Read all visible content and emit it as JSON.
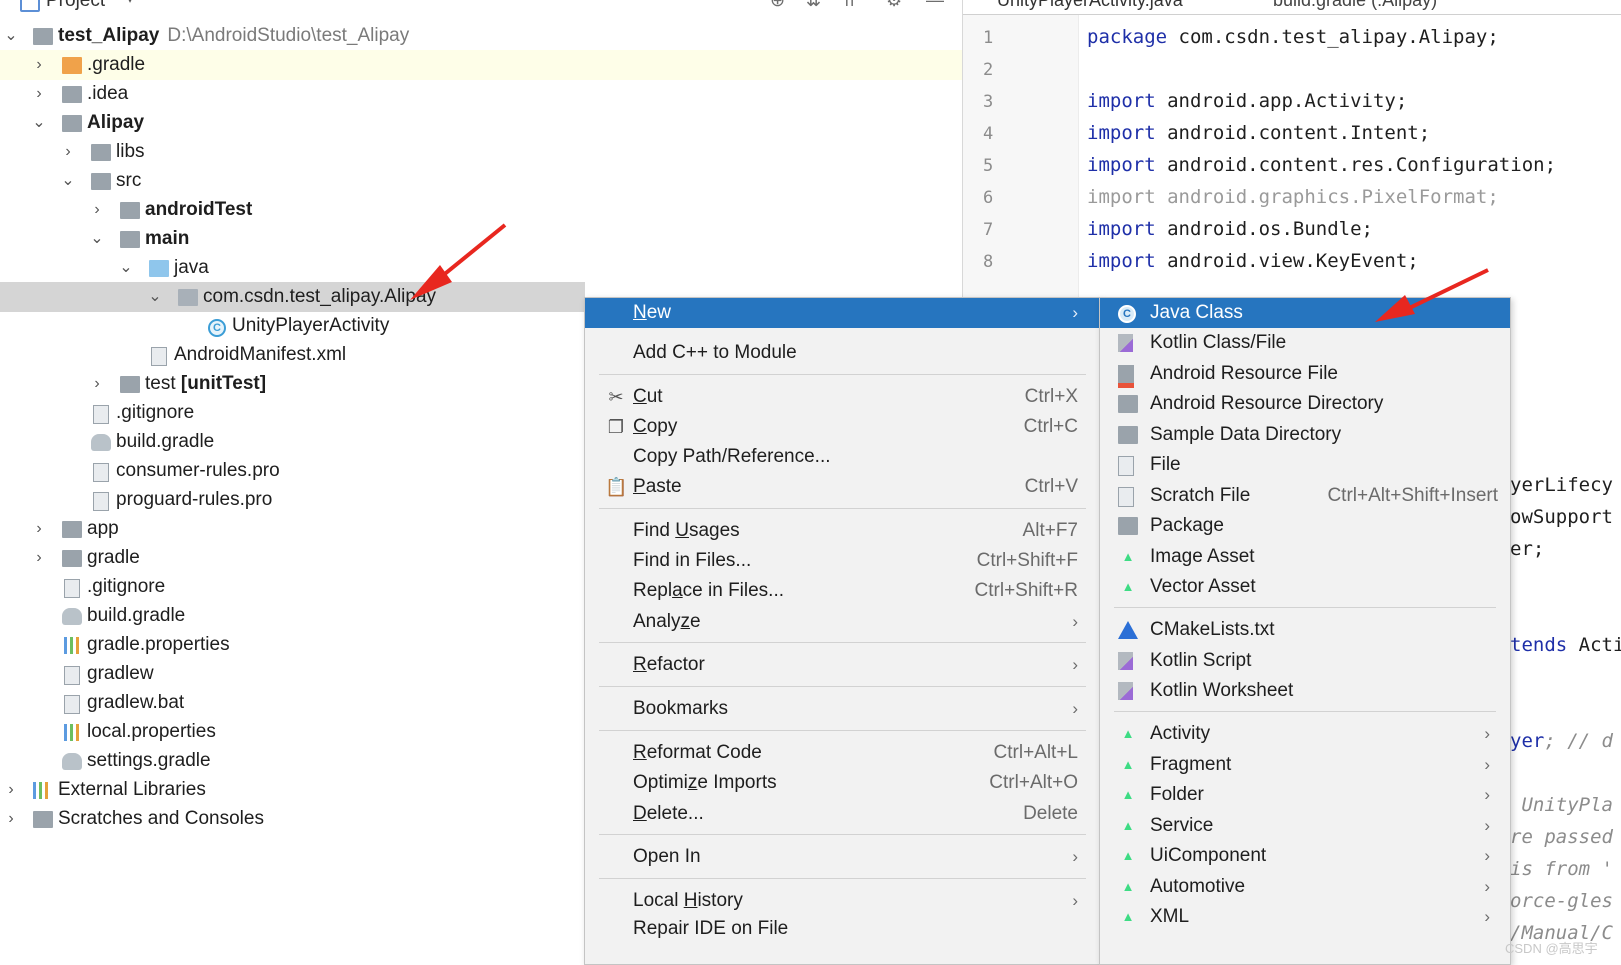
{
  "project_panel": {
    "title": "Project",
    "tree": [
      {
        "label": "test_Alipay",
        "path": "D:\\AndroidStudio\\test_Alipay"
      },
      {
        "label": ".gradle"
      },
      {
        "label": ".idea"
      },
      {
        "label": "Alipay"
      },
      {
        "label": "libs"
      },
      {
        "label": "src"
      },
      {
        "label": "androidTest"
      },
      {
        "label": "main"
      },
      {
        "label": "java"
      },
      {
        "label": "com.csdn.test_alipay.Alipay"
      },
      {
        "label": "UnityPlayerActivity"
      },
      {
        "label": "AndroidManifest.xml"
      },
      {
        "label": "test",
        "suffix": "[unitTest]"
      },
      {
        "label": ".gitignore"
      },
      {
        "label": "build.gradle"
      },
      {
        "label": "consumer-rules.pro"
      },
      {
        "label": "proguard-rules.pro"
      },
      {
        "label": "app"
      },
      {
        "label": "gradle"
      },
      {
        "label": ".gitignore"
      },
      {
        "label": "build.gradle"
      },
      {
        "label": "gradle.properties"
      },
      {
        "label": "gradlew"
      },
      {
        "label": "gradlew.bat"
      },
      {
        "label": "local.properties"
      },
      {
        "label": "settings.gradle"
      },
      {
        "label": "External Libraries"
      },
      {
        "label": "Scratches and Consoles"
      }
    ]
  },
  "editor": {
    "tabs": [
      "UnityPlayerActivity.java",
      "build.gradle (:Alipay)"
    ],
    "lines": [
      {
        "num": "1",
        "kw": "package",
        "rest": " com.csdn.test_alipay.Alipay;"
      },
      {
        "num": "2",
        "kw": "",
        "rest": ""
      },
      {
        "num": "3",
        "kw": "import",
        "rest": " android.app.Activity;"
      },
      {
        "num": "4",
        "kw": "import",
        "rest": " android.content.Intent;"
      },
      {
        "num": "5",
        "kw": "import",
        "rest": " android.content.res.Configuration;"
      },
      {
        "num": "6",
        "kw": "import",
        "rest": " android.graphics.PixelFormat;"
      },
      {
        "num": "7",
        "kw": "import",
        "rest": " android.os.Bundle;"
      },
      {
        "num": "8",
        "kw": "import",
        "rest": " android.view.KeyEvent;"
      }
    ],
    "partial": {
      "p1": "yerLifecy",
      "p2": "owSupport",
      "p3": "er;",
      "p4_kw": "tends",
      "p4_rest": " Acti",
      "p5_kw": "yer",
      "p5_rest": "; // d",
      "p6": " UnityPla",
      "p7": "re passed",
      "p8": "is from '",
      "p9": "orce-gles",
      "p10": "/Manual/C"
    }
  },
  "context_menu": {
    "items": [
      {
        "label": "New",
        "u": "N",
        "rest": "ew"
      },
      {
        "label": "Add C++ to Module"
      },
      {
        "label": "Cut",
        "u": "C",
        "rest": "ut",
        "shortcut": "Ctrl+X"
      },
      {
        "label": "Copy",
        "u": "C",
        "rest": "opy",
        "shortcut": "Ctrl+C"
      },
      {
        "label": "Copy Path/Reference..."
      },
      {
        "label": "Paste",
        "u": "P",
        "rest": "aste",
        "shortcut": "Ctrl+V"
      },
      {
        "label": "Find Usages",
        "pre": "Find ",
        "u": "U",
        "rest": "sages",
        "shortcut": "Alt+F7"
      },
      {
        "label": "Find in Files...",
        "shortcut": "Ctrl+Shift+F"
      },
      {
        "label": "Replace in Files...",
        "pre": "Repl",
        "u": "a",
        "rest": "ce in Files...",
        "shortcut": "Ctrl+Shift+R"
      },
      {
        "label": "Analyze",
        "pre": "Analy",
        "u": "z",
        "rest": "e"
      },
      {
        "label": "Refactor",
        "u": "R",
        "rest": "efactor"
      },
      {
        "label": "Bookmarks"
      },
      {
        "label": "Reformat Code",
        "u": "R",
        "rest": "eformat Code",
        "shortcut": "Ctrl+Alt+L"
      },
      {
        "label": "Optimize Imports",
        "pre": "Optimi",
        "u": "z",
        "rest": "e Imports",
        "shortcut": "Ctrl+Alt+O"
      },
      {
        "label": "Delete...",
        "u": "D",
        "rest": "elete...",
        "shortcut": "Delete"
      },
      {
        "label": "Open In"
      },
      {
        "label": "Local History",
        "pre": "Local ",
        "u": "H",
        "rest": "istory"
      },
      {
        "label": "Repair IDE on File"
      }
    ]
  },
  "new_submenu": {
    "items": [
      {
        "label": "Java Class"
      },
      {
        "label": "Kotlin Class/File"
      },
      {
        "label": "Android Resource File"
      },
      {
        "label": "Android Resource Directory"
      },
      {
        "label": "Sample Data Directory"
      },
      {
        "label": "File"
      },
      {
        "label": "Scratch File",
        "shortcut": "Ctrl+Alt+Shift+Insert"
      },
      {
        "label": "Package"
      },
      {
        "label": "Image Asset"
      },
      {
        "label": "Vector Asset"
      },
      {
        "label": "CMakeLists.txt"
      },
      {
        "label": "Kotlin Script"
      },
      {
        "label": "Kotlin Worksheet"
      },
      {
        "label": "Activity"
      },
      {
        "label": "Fragment"
      },
      {
        "label": "Folder"
      },
      {
        "label": "Service"
      },
      {
        "label": "UiComponent"
      },
      {
        "label": "Automotive"
      },
      {
        "label": "XML"
      }
    ]
  },
  "watermark": "CSDN @高思宇",
  "colors": {
    "menu_selection": "#2675bf",
    "keyword": "#1e2fa8",
    "annotation_arrow": "#e8271f"
  }
}
